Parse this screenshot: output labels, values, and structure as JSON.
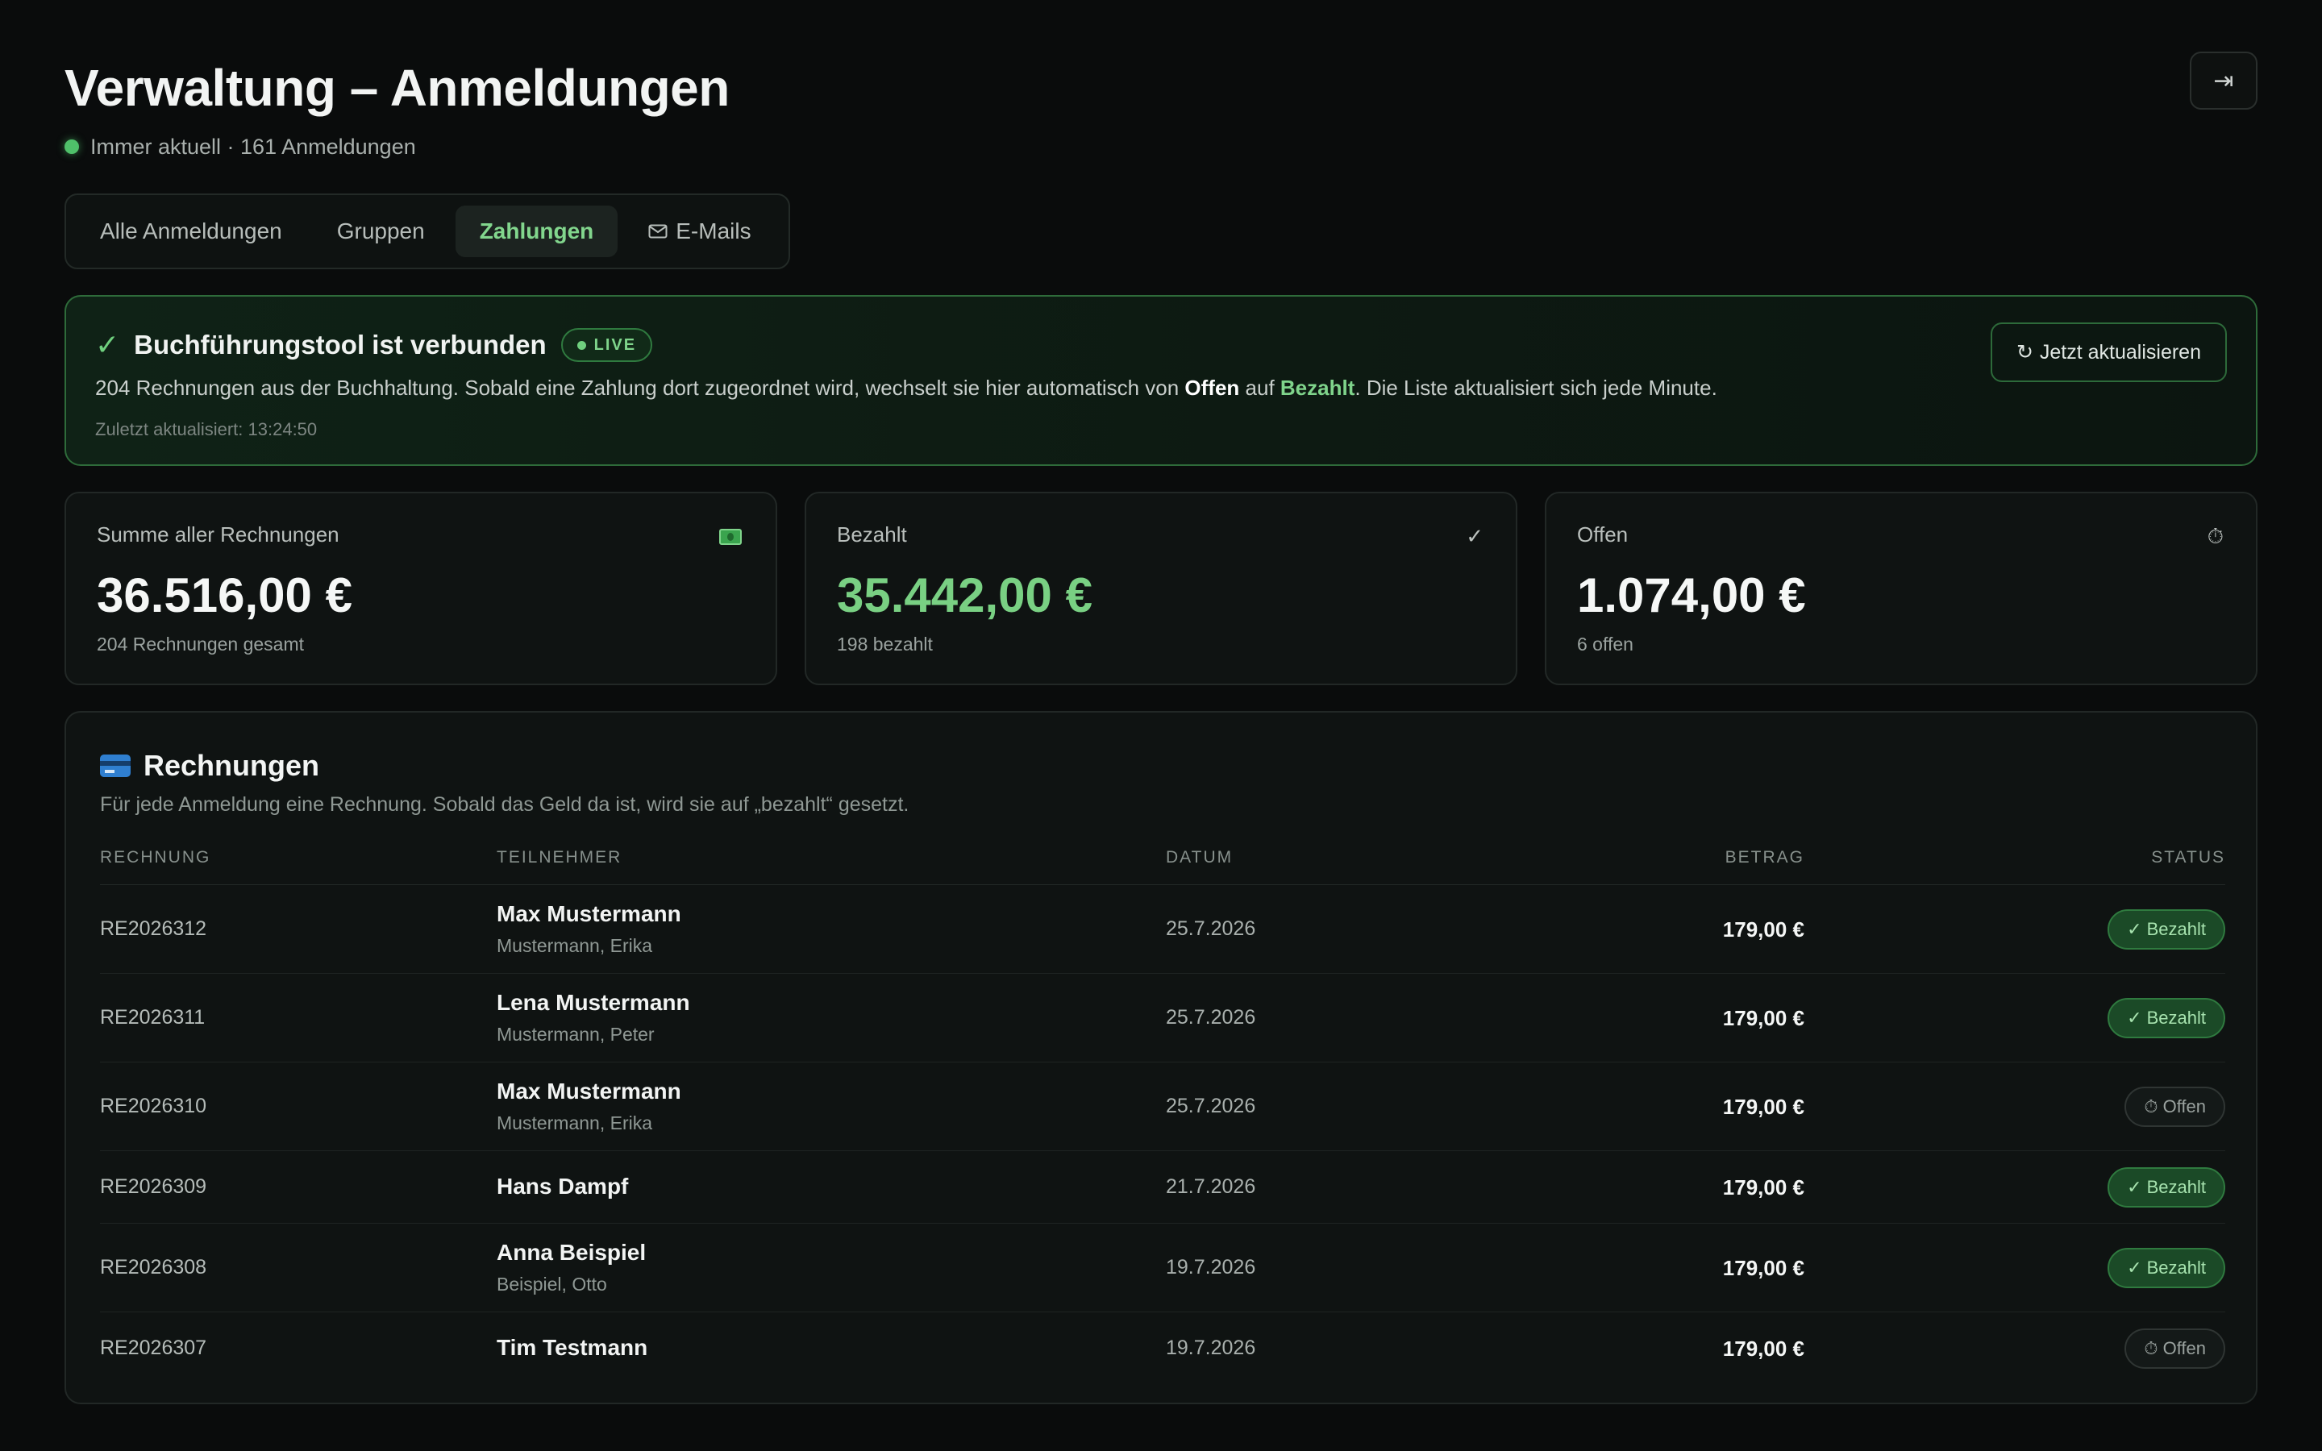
{
  "header": {
    "title": "Verwaltung – Anmeldungen",
    "subtitle": "Immer aktuell · 161 Anmeldungen",
    "logout_icon": "⇥"
  },
  "tabs": [
    {
      "label": "Alle Anmeldungen",
      "active": false
    },
    {
      "label": "Gruppen",
      "active": false
    },
    {
      "label": "Zahlungen",
      "active": true
    },
    {
      "label": "E-Mails",
      "active": false,
      "icon": "mail-icon"
    }
  ],
  "banner": {
    "check": "✓",
    "title": "Buchführungstool ist verbunden",
    "badge": "LIVE",
    "desc_part1": "204 Rechnungen aus der Buchhaltung. Sobald eine Zahlung dort zugeordnet wird, wechselt sie hier automatisch von ",
    "desc_open": "Offen",
    "desc_part2": " auf ",
    "desc_paid": "Bezahlt",
    "desc_part3": ". Die Liste aktualisiert sich jede Minute.",
    "updated": "Zuletzt aktualisiert: 13:24:50",
    "refresh_icon": "↻",
    "refresh_label": "Jetzt aktualisieren"
  },
  "stats": {
    "total": {
      "label": "Summe aller Rechnungen",
      "value": "36.516,00 €",
      "sub": "204 Rechnungen gesamt",
      "icon": "cash-icon"
    },
    "paid": {
      "label": "Bezahlt",
      "value": "35.442,00 €",
      "sub": "198 bezahlt",
      "icon": "✓"
    },
    "open": {
      "label": "Offen",
      "value": "1.074,00 €",
      "sub": "6 offen",
      "icon": "⏱"
    }
  },
  "invoices": {
    "title": "Rechnungen",
    "desc": "Für jede Anmeldung eine Rechnung. Sobald das Geld da ist, wird sie auf „bezahlt“ gesetzt.",
    "columns": [
      "RECHNUNG",
      "TEILNEHMER",
      "DATUM",
      "BETRAG",
      "STATUS"
    ],
    "rows": [
      {
        "number": "RE2026312",
        "name": "Max Mustermann",
        "sub": "Mustermann, Erika",
        "date": "25.7.2026",
        "amount": "179,00 €",
        "status": "✓ Bezahlt",
        "paid": true
      },
      {
        "number": "RE2026311",
        "name": "Lena Mustermann",
        "sub": "Mustermann, Peter",
        "date": "25.7.2026",
        "amount": "179,00 €",
        "status": "✓ Bezahlt",
        "paid": true
      },
      {
        "number": "RE2026310",
        "name": "Max Mustermann",
        "sub": "Mustermann, Erika",
        "date": "25.7.2026",
        "amount": "179,00 €",
        "status": "⏱ Offen",
        "paid": false
      },
      {
        "number": "RE2026309",
        "name": "Hans Dampf",
        "sub": "",
        "date": "21.7.2026",
        "amount": "179,00 €",
        "status": "✓ Bezahlt",
        "paid": true
      },
      {
        "number": "RE2026308",
        "name": "Anna Beispiel",
        "sub": "Beispiel, Otto",
        "date": "19.7.2026",
        "amount": "179,00 €",
        "status": "✓ Bezahlt",
        "paid": true
      },
      {
        "number": "RE2026307",
        "name": "Tim Testmann",
        "sub": "",
        "date": "19.7.2026",
        "amount": "179,00 €",
        "status": "⏱ Offen",
        "paid": false
      }
    ]
  },
  "colors": {
    "accent": "#79d083",
    "background": "#0a0c0c",
    "border_success": "#2e6b3a"
  }
}
